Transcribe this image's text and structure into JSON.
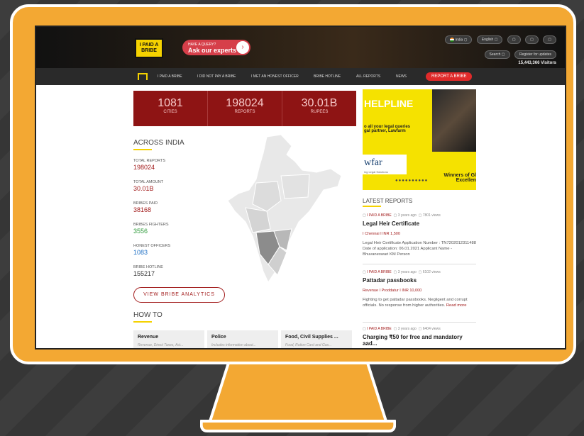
{
  "header": {
    "logo_line1": "I PAID A",
    "logo_line2": "BRIBE",
    "query_small": "HAVE A QUERY?",
    "query_big": "Ask our experts",
    "query_arrow": "›",
    "country": "India",
    "language": "English",
    "search_label": "Search",
    "register_label": "Register for updates",
    "visitors": "15,443,366 Visitors"
  },
  "nav": {
    "items": [
      {
        "label": "I PAID A BRIBE"
      },
      {
        "label": "I DID NOT PAY A BRIBE"
      },
      {
        "label": "I MET AN HONEST OFFICER"
      },
      {
        "label": "BRIBE HOTLINE"
      },
      {
        "label": "ALL REPORTS"
      },
      {
        "label": "NEWS"
      }
    ],
    "report_button": "REPORT A BRIBE"
  },
  "stats": [
    {
      "value": "1081",
      "label": "CITIES"
    },
    {
      "value": "198024",
      "label": "REPORTS"
    },
    {
      "value": "30.01B",
      "label": "RUPEES"
    }
  ],
  "across": {
    "title": "ACROSS INDIA",
    "items": [
      {
        "label": "TOTAL REPORTS",
        "value": "198024",
        "color": "#a21c1c"
      },
      {
        "label": "TOTAL AMOUNT",
        "value": "30.01B",
        "color": "#a21c1c"
      },
      {
        "label": "BRIBES PAID",
        "value": "38168",
        "color": "#a21c1c"
      },
      {
        "label": "BRIBES FIGHTERS",
        "value": "3556",
        "color": "#2e9a3a"
      },
      {
        "label": "HONEST OFFICERS",
        "value": "1083",
        "color": "#1e6fc4"
      },
      {
        "label": "BRIBE HOTLINE",
        "value": "155217",
        "color": "#333333"
      }
    ],
    "analytics_button": "VIEW BRIBE ANALYTICS"
  },
  "howto": {
    "title": "HOW TO",
    "cards": [
      {
        "title": "Revenue",
        "sub": "Revenue, Direct Taxes, Act..."
      },
      {
        "title": "Police",
        "sub": "Includes information about..."
      },
      {
        "title": "Food, Civil Supplies ...",
        "sub": "Food, Ration Card and Gas..."
      }
    ]
  },
  "banner": {
    "headline": "HELPLINE",
    "sub": "o all your legal queries\ngal partner, Lawfarm",
    "brand": "wfar",
    "brand_sub": "ing Legal Solutions",
    "winners": "Winners of Gl Excellen"
  },
  "latest": {
    "title": "LATEST REPORTS",
    "reports": [
      {
        "by": "I PAID A BRIBE",
        "time": "3 years ago",
        "views": "7801 views",
        "title": "Legal Heir Certificate",
        "city": "Chennai",
        "amount": "INR 1,500",
        "body": "Legal Heir Certificate Application Number : TN7202012311488 Date of application: 06.01.2021 Applicant Name - Bhuvaneswari KM Person",
        "more": ""
      },
      {
        "by": "I PAID A BRIBE",
        "time": "3 years ago",
        "views": "6102 views",
        "title": "Pattadar passbooks",
        "city": "Revenue  I  Proddatur",
        "amount": "INR 10,000",
        "body": "Fighting to get pattadar passbooks. Negligent and corrupt officials. No response from higher authorities.",
        "more": "Read more"
      },
      {
        "by": "I PAID A BRIBE",
        "time": "3 years ago",
        "views": "6404 views",
        "title": "Charging ₹50 for free and mandatory aad...",
        "city": "",
        "amount": "",
        "body": "",
        "more": ""
      }
    ]
  }
}
